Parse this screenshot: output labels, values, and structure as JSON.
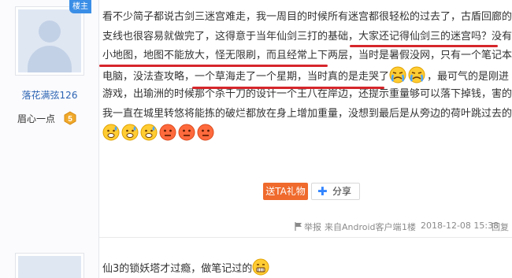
{
  "author": {
    "badge": "楼主",
    "username": "落花满弦126",
    "level_name": "眉心一点",
    "level_number": "5"
  },
  "post": {
    "lines": [
      "看不少简子都说古剑三迷宫难走，我一周目的时候所有迷宫都很轻松的过去了，古盾回廊的",
      "支线也很容易就做完了，这得意于当年仙剑三打的基础，大家还记得仙剑三的迷宫吗？没有",
      "小地图，地图不能放大，怪无限刷，而且经常上下两层，当时是暑假没网，只有一个笔记本",
      "电脑，没法查攻略，一个草海走了一个星期，当时真的是走哭了",
      "，最可气的是刚进",
      "游戏，出瑜洲的时候那个杀千刀的设计一个王八在岸边，还提示重量够可以落下掉钱，害的",
      "我一直在城里转悠将能拣的破烂都放在身上增加重量，没想到最后是从旁边的荷叶跳过去的"
    ],
    "emoji_line_1": [
      "cry-face",
      "cry-face"
    ],
    "emoji_line_2": [
      "sweat-face",
      "sweat-face",
      "sweat-face",
      "red-face",
      "red-face",
      "red-face"
    ]
  },
  "actions": {
    "gift_label": "送TA礼物",
    "share_label": "分享"
  },
  "meta": {
    "report_label": "举报",
    "source": "来自Android客户端",
    "floor": "1楼",
    "timestamp": "2018-12-08 15:38",
    "reply_label": "回复"
  },
  "next_reply": {
    "text": "仙3的锁妖塔才过瘾，做笔记过的"
  },
  "colors": {
    "accent_blue": "#3a8ee6",
    "username_blue": "#2d64b3",
    "gift_orange": "#ef6a2c",
    "underline_red": "#d6262b",
    "badge_gold": "#f0a92b"
  }
}
